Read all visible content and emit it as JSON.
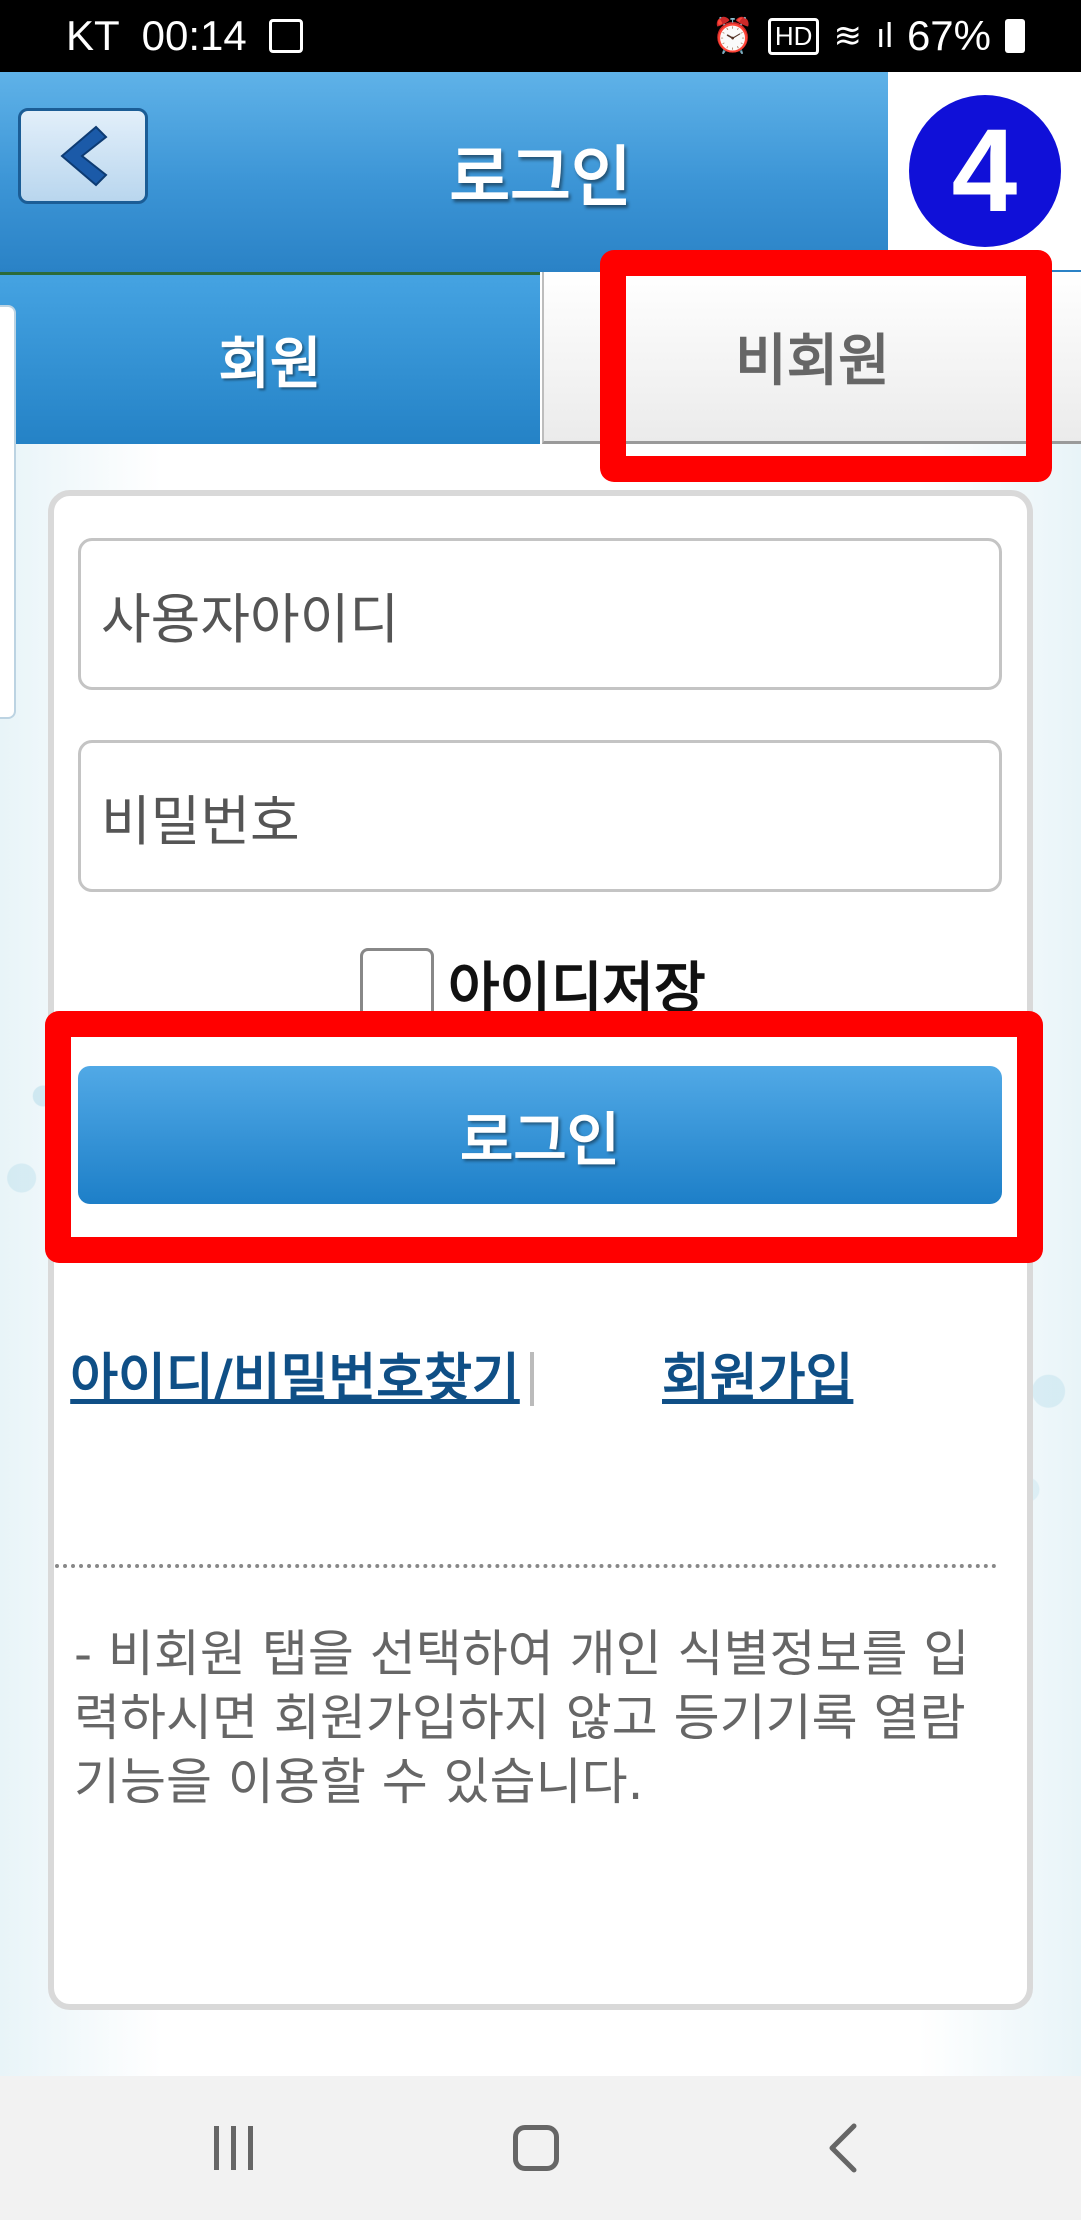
{
  "status_bar": {
    "carrier": "KT",
    "time": "00:14",
    "hd_label": "HD",
    "battery_percent": "67%",
    "icons": [
      "image-icon",
      "alarm-icon",
      "hd-icon",
      "wifi-icon",
      "signal-icon",
      "battery-icon"
    ]
  },
  "header": {
    "title": "로그인",
    "back_icon": "chevron-left-icon",
    "step_badge": "4"
  },
  "tabs": [
    {
      "label": "회원",
      "selected": true
    },
    {
      "label": "비회원",
      "selected": false
    }
  ],
  "form": {
    "user_id_placeholder": "사용자아이디",
    "password_placeholder": "비밀번호",
    "save_id_label": "아이디저장",
    "save_id_checked": false,
    "login_button": "로그인"
  },
  "links": {
    "find_account": "아이디/비밀번호찾기",
    "sign_up": "회원가입"
  },
  "notice": "- 비회원 탭을 선택하여 개인 식별정보를 입력하시면 회원가입하지 않고 등기기록 열람기능을 이용할 수 있습니다.",
  "highlight_color": "#ff0000",
  "accent_color": "#2482c6",
  "nav_bar": {
    "icons": [
      "recents-icon",
      "home-icon",
      "back-icon"
    ]
  }
}
